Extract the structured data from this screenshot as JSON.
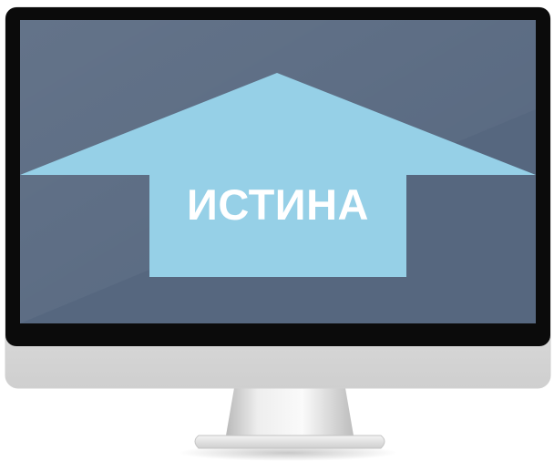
{
  "monitor": {
    "icon": "monitor-icon",
    "screen_color": "#56677f",
    "bezel_color": "#0b0b0b"
  },
  "arrow": {
    "icon": "up-arrow-icon",
    "direction": "up",
    "color": "#96d0e7",
    "label": "ИСТИНА",
    "label_color": "#ffffff"
  }
}
